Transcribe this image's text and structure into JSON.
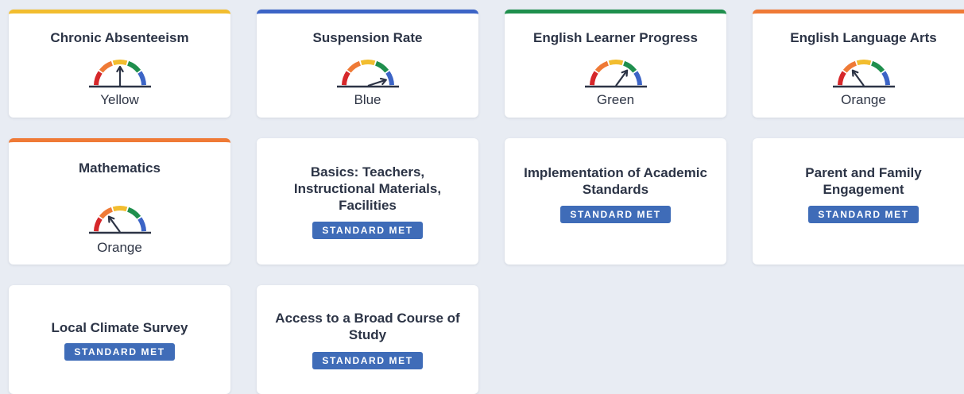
{
  "colors": {
    "yellow": "#f2bd2f",
    "blue": "#3c64c6",
    "green": "#1f8f4d",
    "orange": "#ef7a36",
    "red": "#d6272a",
    "badge": "#3f6cb8"
  },
  "indicators": [
    {
      "title": "Chronic Absenteeism",
      "level": "Yellow",
      "accent": "yellow",
      "needle_value": 3
    },
    {
      "title": "Suspension Rate",
      "level": "Blue",
      "accent": "blue",
      "needle_value": 5
    },
    {
      "title": "English Learner Progress",
      "level": "Green",
      "accent": "green",
      "needle_value": 4
    },
    {
      "title": "English Language Arts",
      "level": "Orange",
      "accent": "orange",
      "needle_value": 2
    },
    {
      "title": "Mathematics",
      "level": "Orange",
      "accent": "orange",
      "needle_value": 2
    }
  ],
  "local_indicators": [
    {
      "title": "Basics: Teachers, Instructional Materials, Facilities",
      "status": "STANDARD MET"
    },
    {
      "title": "Implementation of Academic Standards",
      "status": "STANDARD MET"
    },
    {
      "title": "Parent and Family Engagement",
      "status": "STANDARD MET"
    },
    {
      "title": "Local Climate Survey",
      "status": "STANDARD MET"
    },
    {
      "title": "Access to a Broad Course of Study",
      "status": "STANDARD MET"
    }
  ]
}
